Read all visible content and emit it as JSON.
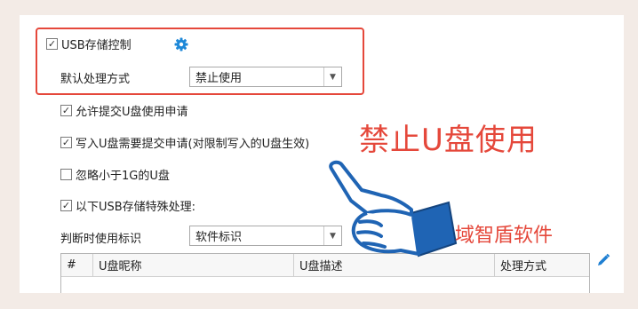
{
  "usb_control": {
    "checked": true,
    "label": "USB存储控制"
  },
  "default_action": {
    "label": "默认处理方式",
    "value": "禁止使用"
  },
  "options": [
    {
      "checked": true,
      "label": "允许提交U盘使用申请"
    },
    {
      "checked": true,
      "label": "写入U盘需要提交申请(对限制写入的U盘生效)"
    },
    {
      "checked": false,
      "label": "忽略小于1G的U盘"
    },
    {
      "checked": true,
      "label": "以下USB存储特殊处理:"
    }
  ],
  "identify_by": {
    "label": "判断时使用标识",
    "value": "软件标识"
  },
  "table": {
    "columns": [
      "#",
      "U盘昵称",
      "U盘描述",
      "处理方式"
    ]
  },
  "annotations": {
    "headline": "禁止U盘使用",
    "brand": "域智盾软件"
  },
  "colors": {
    "accent_red": "#e5483b",
    "gear_blue": "#1e88d8",
    "pencil_blue": "#1e7fd2",
    "hand_blue": "#1f64b4"
  }
}
